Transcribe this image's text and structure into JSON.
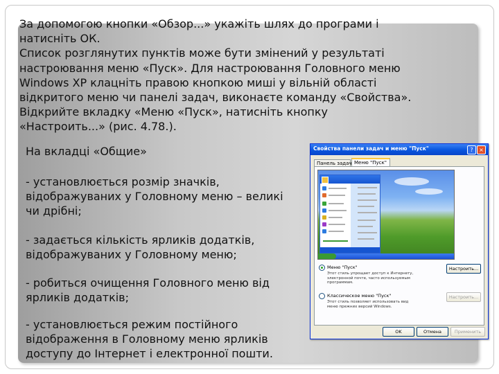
{
  "intro_text": "За допомогою кнопки «Обзор...» укажіть шлях до програми і\nнатисніть ОК.\nСписок розглянутих пунктів може бути змінений у результаті\nнастроювання меню «Пуск». Для настроювання Головного меню\nWindows XP клацніть правою кнопкою миші у вільній області\nвідкритого меню чи панелі задач, виконаєте команду «Свойства».\nВідкрийте вкладку «Меню «Пуск», натисніть кнопку\n«Настроить...» (рис. 4.78.).",
  "left_column": {
    "heading": "На вкладці «Общие»",
    "bullets": [
      "- установлюється розмір значків, відображуваних у Головному меню – великі чи дрібні;",
      "- задається кількість ярликів додатків, відображуваних у Головному меню;",
      "- робиться очищення Головного меню від ярликів додатків;",
      "- установлюється режим постійного відображення в Головному меню ярликів доступу до Інтернет і електронної пошти."
    ]
  },
  "dialog": {
    "title": "Свойства панели задач и меню \"Пуск\"",
    "title_buttons": {
      "help": "?",
      "close": "×"
    },
    "tabs": [
      "Панель задач",
      "Меню \"Пуск\""
    ],
    "active_tab": "Меню \"Пуск\"",
    "option1": {
      "label": "Меню \"Пуск\"",
      "description": "Этот стиль упрощает доступ к Интернету, электронной почте, часто используемым программам.",
      "button": "Настроить...",
      "selected": true
    },
    "option2": {
      "label": "Классическое меню \"Пуск\"",
      "description": "Этот стиль позволяет использовать вид меню прежних версий Windows.",
      "button": "Настроить...",
      "selected": false
    },
    "footer_buttons": {
      "ok": "OK",
      "cancel": "Отмена",
      "apply": "Применить"
    },
    "colors": {
      "titlebar": "#0a58e0",
      "face": "#ece9d8",
      "tab_highlight": "#ffc83c"
    }
  },
  "icons": [
    "help-icon",
    "close-icon",
    "radio-selected-icon",
    "radio-unselected-icon"
  ]
}
